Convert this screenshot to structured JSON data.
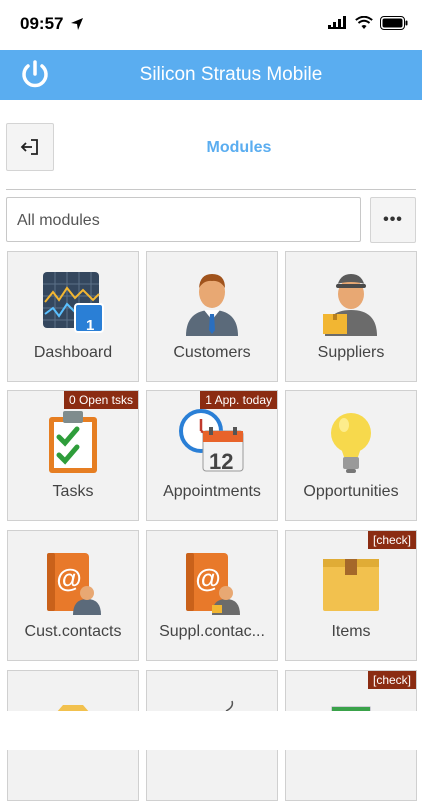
{
  "status_bar": {
    "time": "09:57"
  },
  "header": {
    "title": "Silicon Stratus Mobile"
  },
  "page": {
    "title": "Modules"
  },
  "filter": {
    "value": "All modules",
    "more_label": "•••"
  },
  "tiles": [
    {
      "label": "Dashboard",
      "badge": ""
    },
    {
      "label": "Customers",
      "badge": ""
    },
    {
      "label": "Suppliers",
      "badge": ""
    },
    {
      "label": "Tasks",
      "badge": "0 Open tsks"
    },
    {
      "label": "Appointments",
      "badge": "1 App. today"
    },
    {
      "label": "Opportunities",
      "badge": ""
    },
    {
      "label": "Cust.contacts",
      "badge": ""
    },
    {
      "label": "Suppl.contac...",
      "badge": ""
    },
    {
      "label": "Items",
      "badge": "[check]"
    },
    {
      "label": "",
      "badge": ""
    },
    {
      "label": "",
      "badge": ""
    },
    {
      "label": "",
      "badge": "[check]"
    }
  ],
  "calendar_day": "12",
  "dashboard_number": "1",
  "colors": {
    "header": "#5aadf0",
    "accent": "#5aadf0",
    "badge": "#8b2c12",
    "tile_bg": "#f2f2f2"
  }
}
